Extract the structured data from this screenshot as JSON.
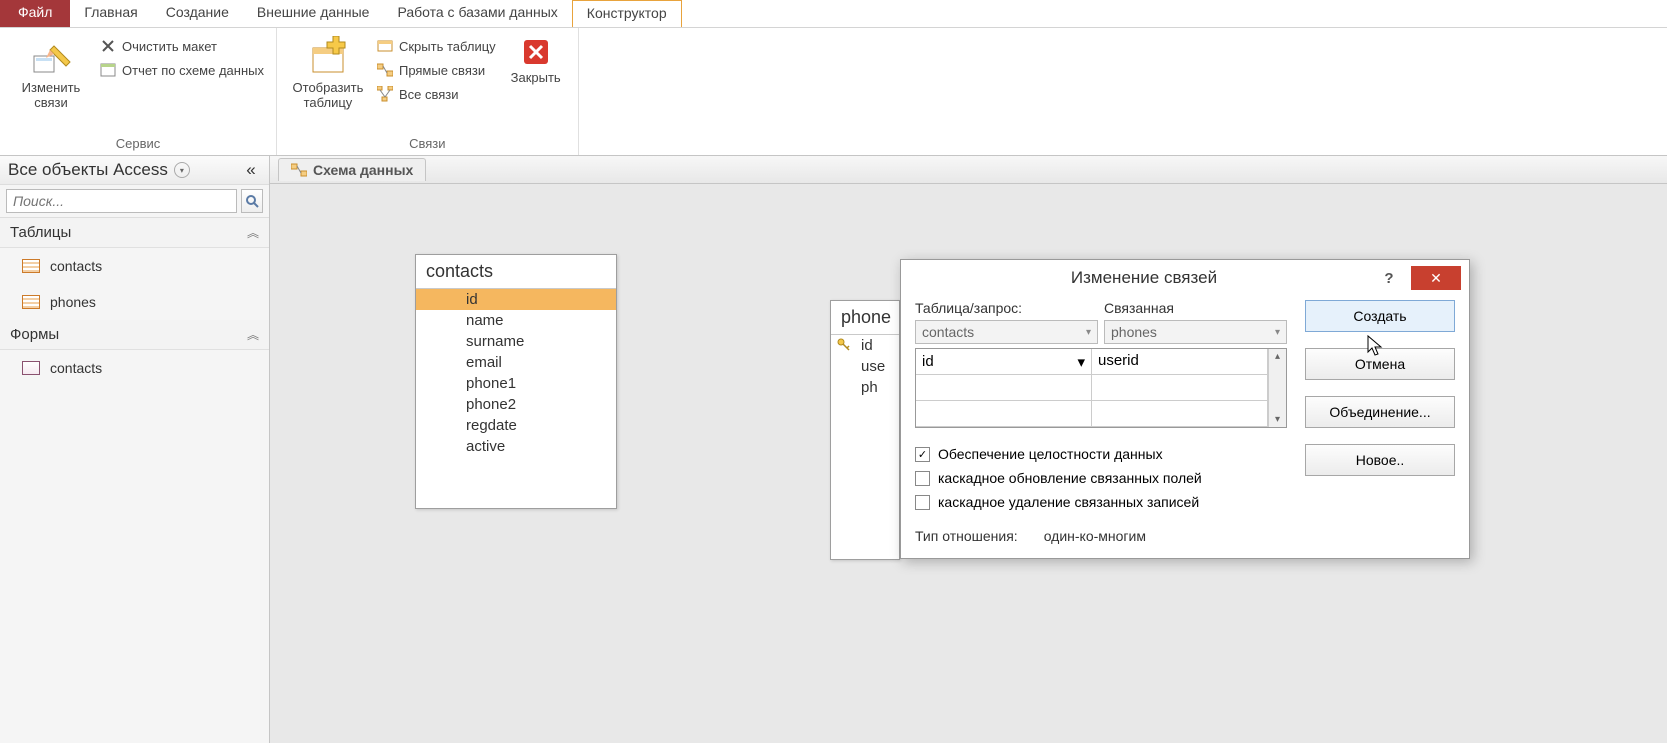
{
  "ribbon_tabs": {
    "file": "Файл",
    "home": "Главная",
    "create": "Создание",
    "external": "Внешние данные",
    "dbtools": "Работа с базами данных",
    "designer": "Конструктор"
  },
  "ribbon": {
    "group_service": "Сервис",
    "group_relations": "Связи",
    "edit_relations": "Изменить связи",
    "clear_layout": "Очистить макет",
    "relation_report": "Отчет по схеме данных",
    "show_table": "Отобразить таблицу",
    "hide_table": "Скрыть таблицу",
    "direct_relations": "Прямые связи",
    "all_relations": "Все связи",
    "close": "Закрыть"
  },
  "sidebar": {
    "title": "Все объекты Access",
    "collapse": "«",
    "search_placeholder": "Поиск...",
    "section_tables": "Таблицы",
    "section_forms": "Формы",
    "items_tables": [
      "contacts",
      "phones"
    ],
    "items_forms": [
      "contacts"
    ]
  },
  "doc_tab": "Схема данных",
  "table_contacts": {
    "title": "contacts",
    "fields": [
      "id",
      "name",
      "surname",
      "email",
      "phone1",
      "phone2",
      "regdate",
      "active"
    ]
  },
  "table_phones": {
    "title": "phone",
    "fields": [
      "id",
      "use",
      "ph"
    ]
  },
  "dialog": {
    "title": "Изменение связей",
    "lbl_table": "Таблица/запрос:",
    "lbl_related": "Связанная",
    "combo_left": "contacts",
    "combo_right": "phones",
    "map_left": "id",
    "map_right": "userid",
    "chk_integrity": "Обеспечение целостности данных",
    "chk_cascade_update": "каскадное обновление связанных полей",
    "chk_cascade_delete": "каскадное удаление связанных записей",
    "lbl_reltype": "Тип отношения:",
    "reltype_value": "один-ко-многим",
    "btn_create": "Создать",
    "btn_cancel": "Отмена",
    "btn_join": "Объединение...",
    "btn_new": "Новое..",
    "help": "?",
    "close": "✕"
  }
}
